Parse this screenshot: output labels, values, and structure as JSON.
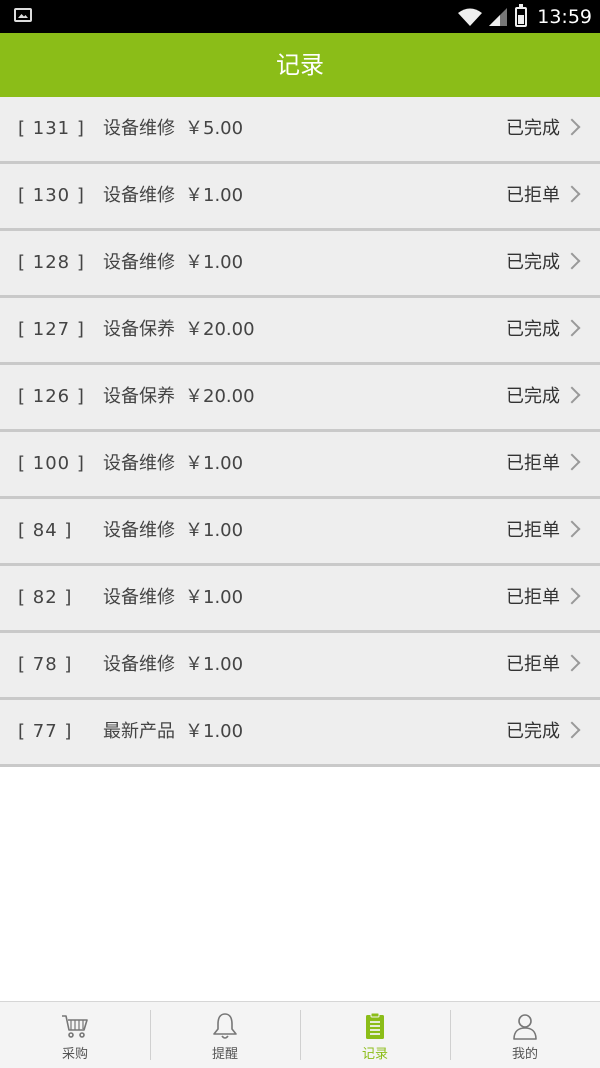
{
  "status_bar": {
    "time": "13:59"
  },
  "header": {
    "title": "记录"
  },
  "records": [
    {
      "id": "[ 131 ]",
      "service": "设备维修",
      "price": "￥5.00",
      "status": "已完成"
    },
    {
      "id": "[ 130 ]",
      "service": "设备维修",
      "price": "￥1.00",
      "status": "已拒单"
    },
    {
      "id": "[ 128 ]",
      "service": "设备维修",
      "price": "￥1.00",
      "status": "已完成"
    },
    {
      "id": "[ 127 ]",
      "service": "设备保养",
      "price": "￥20.00",
      "status": "已完成"
    },
    {
      "id": "[ 126 ]",
      "service": "设备保养",
      "price": "￥20.00",
      "status": "已完成"
    },
    {
      "id": "[ 100 ]",
      "service": "设备维修",
      "price": "￥1.00",
      "status": "已拒单"
    },
    {
      "id": "[ 84 ]",
      "service": "设备维修",
      "price": "￥1.00",
      "status": "已拒单"
    },
    {
      "id": "[ 82 ]",
      "service": "设备维修",
      "price": "￥1.00",
      "status": "已拒单"
    },
    {
      "id": "[ 78 ]",
      "service": "设备维修",
      "price": "￥1.00",
      "status": "已拒单"
    },
    {
      "id": "[ 77 ]",
      "service": "最新产品",
      "price": "￥1.00",
      "status": "已完成"
    }
  ],
  "tabs": [
    {
      "label": "采购",
      "icon": "cart-icon"
    },
    {
      "label": "提醒",
      "icon": "bell-icon"
    },
    {
      "label": "记录",
      "icon": "clipboard-icon",
      "active": true
    },
    {
      "label": "我的",
      "icon": "user-icon"
    }
  ],
  "colors": {
    "accent": "#8bbd18",
    "row_bg": "#eeeeee",
    "divider": "#c9c9c9"
  }
}
